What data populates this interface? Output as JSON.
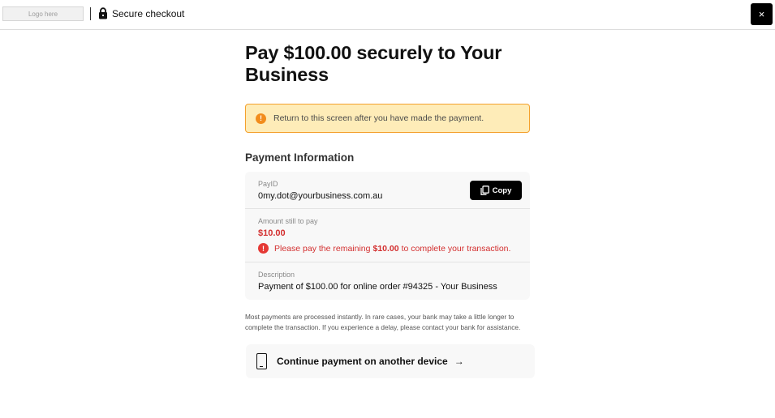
{
  "header": {
    "logo_text": "Logo here",
    "secure_label": "Secure checkout",
    "lock_icon": "lock-icon",
    "close_label": "×"
  },
  "main": {
    "title": "Pay $100.00 securely to Your Business",
    "alert": {
      "icon": "!",
      "text": "Return to this screen after you have made the payment.",
      "color": "#f4a12e"
    },
    "section_title": "Payment Information",
    "payid": {
      "label": "PayID",
      "value": "0my.dot@yourbusiness.com.au",
      "copy_label": "Copy"
    },
    "amount": {
      "label": "Amount still to pay",
      "value": "$10.00",
      "error_icon": "!",
      "error_prefix": "Please pay the remaining",
      "error_amount": "$10.00",
      "error_suffix": "to complete your transaction.",
      "color": "#d32f2f"
    },
    "description": {
      "label": "Description",
      "value": "Payment of $100.00 for online order #94325 - Your Business"
    },
    "note": "Most payments are processed instantly. In rare cases, your bank may take a little longer to complete the transaction. If you experience a delay, please contact your bank for assistance.",
    "continue_label": "Continue payment on another device",
    "continue_arrow": "→"
  }
}
